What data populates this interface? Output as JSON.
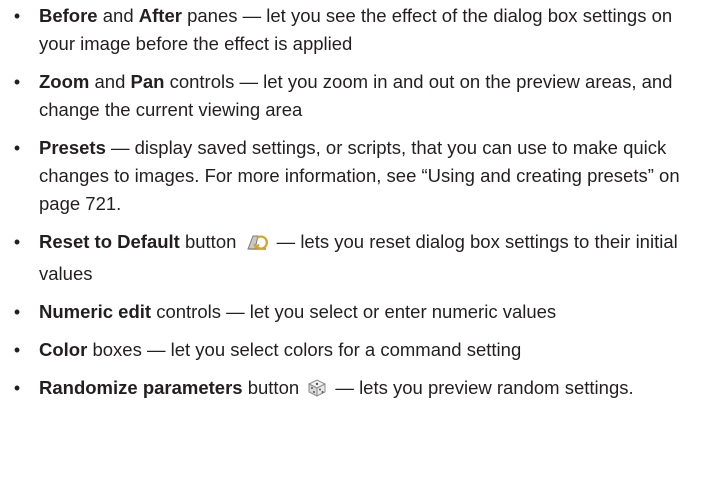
{
  "bullet_char": "•",
  "items": [
    {
      "t1": "Before",
      "m1": " and ",
      "t2": "After",
      "rest": " panes — let you see the effect of the dialog box settings on your image before the effect is applied"
    },
    {
      "t1": "Zoom",
      "m1": " and ",
      "t2": "Pan",
      "rest": " controls — let you zoom in and out on the preview areas, and change the current viewing area"
    },
    {
      "t1": "Presets",
      "rest": " — display saved settings, or scripts, that you can use to make quick changes to images. For more information, see “Using and creating presets” on page 721."
    },
    {
      "t1": "Reset to Default",
      "pre_icon": " button ",
      "icon": "reset-to-default-icon",
      "rest": " — lets you reset dialog box settings to their initial values"
    },
    {
      "t1": "Numeric edit",
      "rest": " controls — let you select or enter numeric values"
    },
    {
      "t1": "Color",
      "rest": " boxes — let you select colors for a command setting"
    },
    {
      "t1": "Randomize parameters",
      "pre_icon": " button ",
      "icon": "randomize-dice-icon",
      "rest": " — lets you preview random settings."
    }
  ]
}
